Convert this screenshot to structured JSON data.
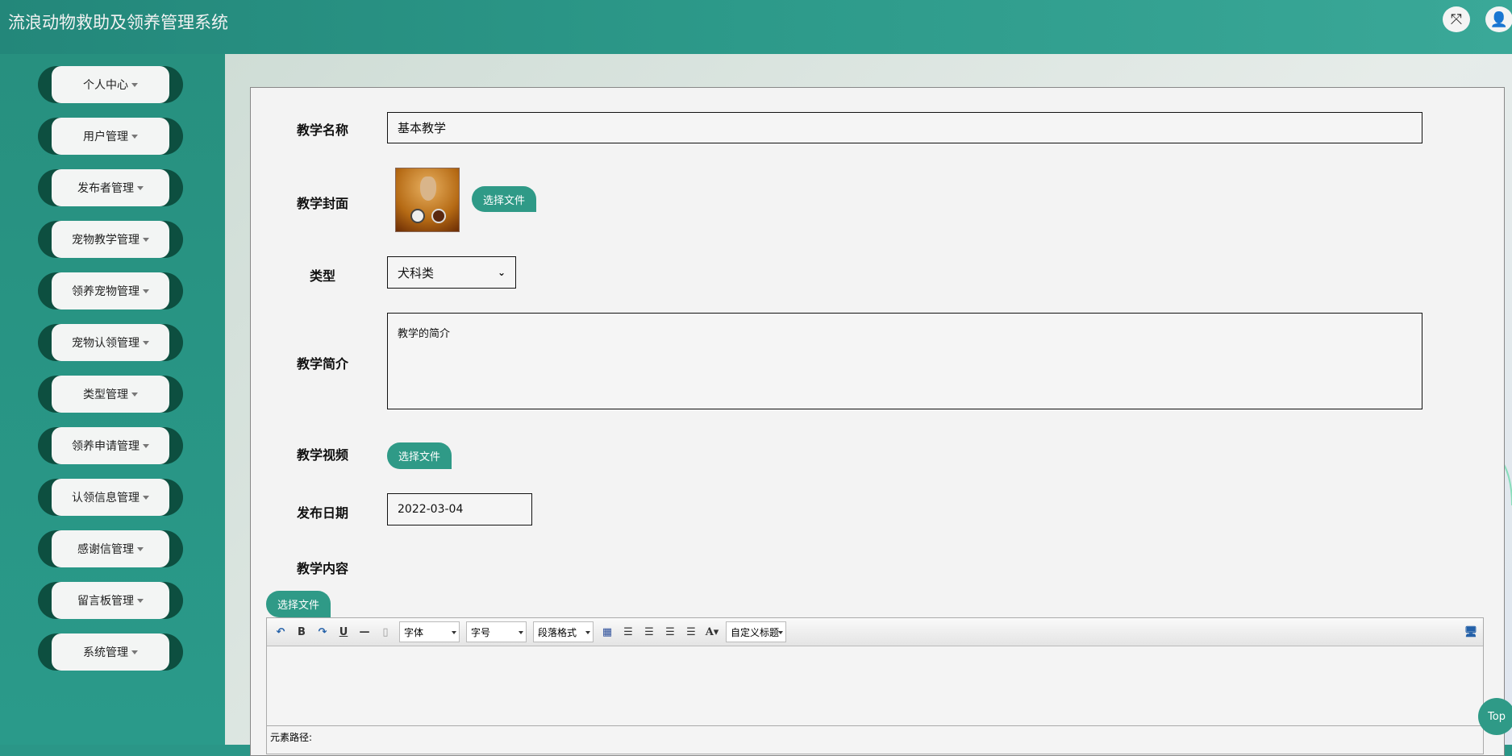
{
  "header": {
    "title": "流浪动物救助及领养管理系统",
    "fullscreen_icon": "expand-icon",
    "user_icon": "user-icon"
  },
  "sidebar": {
    "items": [
      {
        "label": "个人中心"
      },
      {
        "label": "用户管理"
      },
      {
        "label": "发布者管理"
      },
      {
        "label": "宠物教学管理"
      },
      {
        "label": "领养宠物管理"
      },
      {
        "label": "宠物认领管理"
      },
      {
        "label": "类型管理"
      },
      {
        "label": "领养申请管理"
      },
      {
        "label": "认领信息管理"
      },
      {
        "label": "感谢信管理"
      },
      {
        "label": "留言板管理"
      },
      {
        "label": "系统管理"
      }
    ]
  },
  "form": {
    "name_label": "教学名称",
    "name_value": "基本教学",
    "cover_label": "教学封面",
    "choose_file": "选择文件",
    "type_label": "类型",
    "type_value": "犬科类",
    "intro_label": "教学简介",
    "intro_value": "教学的简介",
    "video_label": "教学视频",
    "date_label": "发布日期",
    "date_value": "2022-03-04",
    "content_label": "教学内容"
  },
  "editor": {
    "font": "字体",
    "size": "字号",
    "paragraph": "段落格式",
    "custom_title": "自定义标题",
    "path_label": "元素路径:"
  },
  "top_button": "Top"
}
